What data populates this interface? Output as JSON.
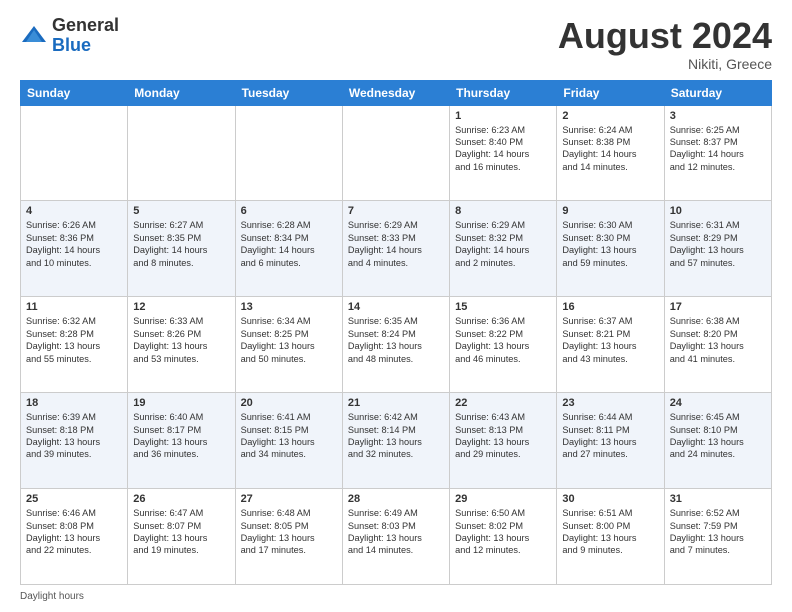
{
  "header": {
    "logo_general": "General",
    "logo_blue": "Blue",
    "month_year": "August 2024",
    "location": "Nikiti, Greece"
  },
  "footer": {
    "daylight_label": "Daylight hours"
  },
  "weekdays": [
    "Sunday",
    "Monday",
    "Tuesday",
    "Wednesday",
    "Thursday",
    "Friday",
    "Saturday"
  ],
  "weeks": [
    [
      {
        "day": "",
        "info": ""
      },
      {
        "day": "",
        "info": ""
      },
      {
        "day": "",
        "info": ""
      },
      {
        "day": "",
        "info": ""
      },
      {
        "day": "1",
        "info": "Sunrise: 6:23 AM\nSunset: 8:40 PM\nDaylight: 14 hours\nand 16 minutes."
      },
      {
        "day": "2",
        "info": "Sunrise: 6:24 AM\nSunset: 8:38 PM\nDaylight: 14 hours\nand 14 minutes."
      },
      {
        "day": "3",
        "info": "Sunrise: 6:25 AM\nSunset: 8:37 PM\nDaylight: 14 hours\nand 12 minutes."
      }
    ],
    [
      {
        "day": "4",
        "info": "Sunrise: 6:26 AM\nSunset: 8:36 PM\nDaylight: 14 hours\nand 10 minutes."
      },
      {
        "day": "5",
        "info": "Sunrise: 6:27 AM\nSunset: 8:35 PM\nDaylight: 14 hours\nand 8 minutes."
      },
      {
        "day": "6",
        "info": "Sunrise: 6:28 AM\nSunset: 8:34 PM\nDaylight: 14 hours\nand 6 minutes."
      },
      {
        "day": "7",
        "info": "Sunrise: 6:29 AM\nSunset: 8:33 PM\nDaylight: 14 hours\nand 4 minutes."
      },
      {
        "day": "8",
        "info": "Sunrise: 6:29 AM\nSunset: 8:32 PM\nDaylight: 14 hours\nand 2 minutes."
      },
      {
        "day": "9",
        "info": "Sunrise: 6:30 AM\nSunset: 8:30 PM\nDaylight: 13 hours\nand 59 minutes."
      },
      {
        "day": "10",
        "info": "Sunrise: 6:31 AM\nSunset: 8:29 PM\nDaylight: 13 hours\nand 57 minutes."
      }
    ],
    [
      {
        "day": "11",
        "info": "Sunrise: 6:32 AM\nSunset: 8:28 PM\nDaylight: 13 hours\nand 55 minutes."
      },
      {
        "day": "12",
        "info": "Sunrise: 6:33 AM\nSunset: 8:26 PM\nDaylight: 13 hours\nand 53 minutes."
      },
      {
        "day": "13",
        "info": "Sunrise: 6:34 AM\nSunset: 8:25 PM\nDaylight: 13 hours\nand 50 minutes."
      },
      {
        "day": "14",
        "info": "Sunrise: 6:35 AM\nSunset: 8:24 PM\nDaylight: 13 hours\nand 48 minutes."
      },
      {
        "day": "15",
        "info": "Sunrise: 6:36 AM\nSunset: 8:22 PM\nDaylight: 13 hours\nand 46 minutes."
      },
      {
        "day": "16",
        "info": "Sunrise: 6:37 AM\nSunset: 8:21 PM\nDaylight: 13 hours\nand 43 minutes."
      },
      {
        "day": "17",
        "info": "Sunrise: 6:38 AM\nSunset: 8:20 PM\nDaylight: 13 hours\nand 41 minutes."
      }
    ],
    [
      {
        "day": "18",
        "info": "Sunrise: 6:39 AM\nSunset: 8:18 PM\nDaylight: 13 hours\nand 39 minutes."
      },
      {
        "day": "19",
        "info": "Sunrise: 6:40 AM\nSunset: 8:17 PM\nDaylight: 13 hours\nand 36 minutes."
      },
      {
        "day": "20",
        "info": "Sunrise: 6:41 AM\nSunset: 8:15 PM\nDaylight: 13 hours\nand 34 minutes."
      },
      {
        "day": "21",
        "info": "Sunrise: 6:42 AM\nSunset: 8:14 PM\nDaylight: 13 hours\nand 32 minutes."
      },
      {
        "day": "22",
        "info": "Sunrise: 6:43 AM\nSunset: 8:13 PM\nDaylight: 13 hours\nand 29 minutes."
      },
      {
        "day": "23",
        "info": "Sunrise: 6:44 AM\nSunset: 8:11 PM\nDaylight: 13 hours\nand 27 minutes."
      },
      {
        "day": "24",
        "info": "Sunrise: 6:45 AM\nSunset: 8:10 PM\nDaylight: 13 hours\nand 24 minutes."
      }
    ],
    [
      {
        "day": "25",
        "info": "Sunrise: 6:46 AM\nSunset: 8:08 PM\nDaylight: 13 hours\nand 22 minutes."
      },
      {
        "day": "26",
        "info": "Sunrise: 6:47 AM\nSunset: 8:07 PM\nDaylight: 13 hours\nand 19 minutes."
      },
      {
        "day": "27",
        "info": "Sunrise: 6:48 AM\nSunset: 8:05 PM\nDaylight: 13 hours\nand 17 minutes."
      },
      {
        "day": "28",
        "info": "Sunrise: 6:49 AM\nSunset: 8:03 PM\nDaylight: 13 hours\nand 14 minutes."
      },
      {
        "day": "29",
        "info": "Sunrise: 6:50 AM\nSunset: 8:02 PM\nDaylight: 13 hours\nand 12 minutes."
      },
      {
        "day": "30",
        "info": "Sunrise: 6:51 AM\nSunset: 8:00 PM\nDaylight: 13 hours\nand 9 minutes."
      },
      {
        "day": "31",
        "info": "Sunrise: 6:52 AM\nSunset: 7:59 PM\nDaylight: 13 hours\nand 7 minutes."
      }
    ]
  ]
}
